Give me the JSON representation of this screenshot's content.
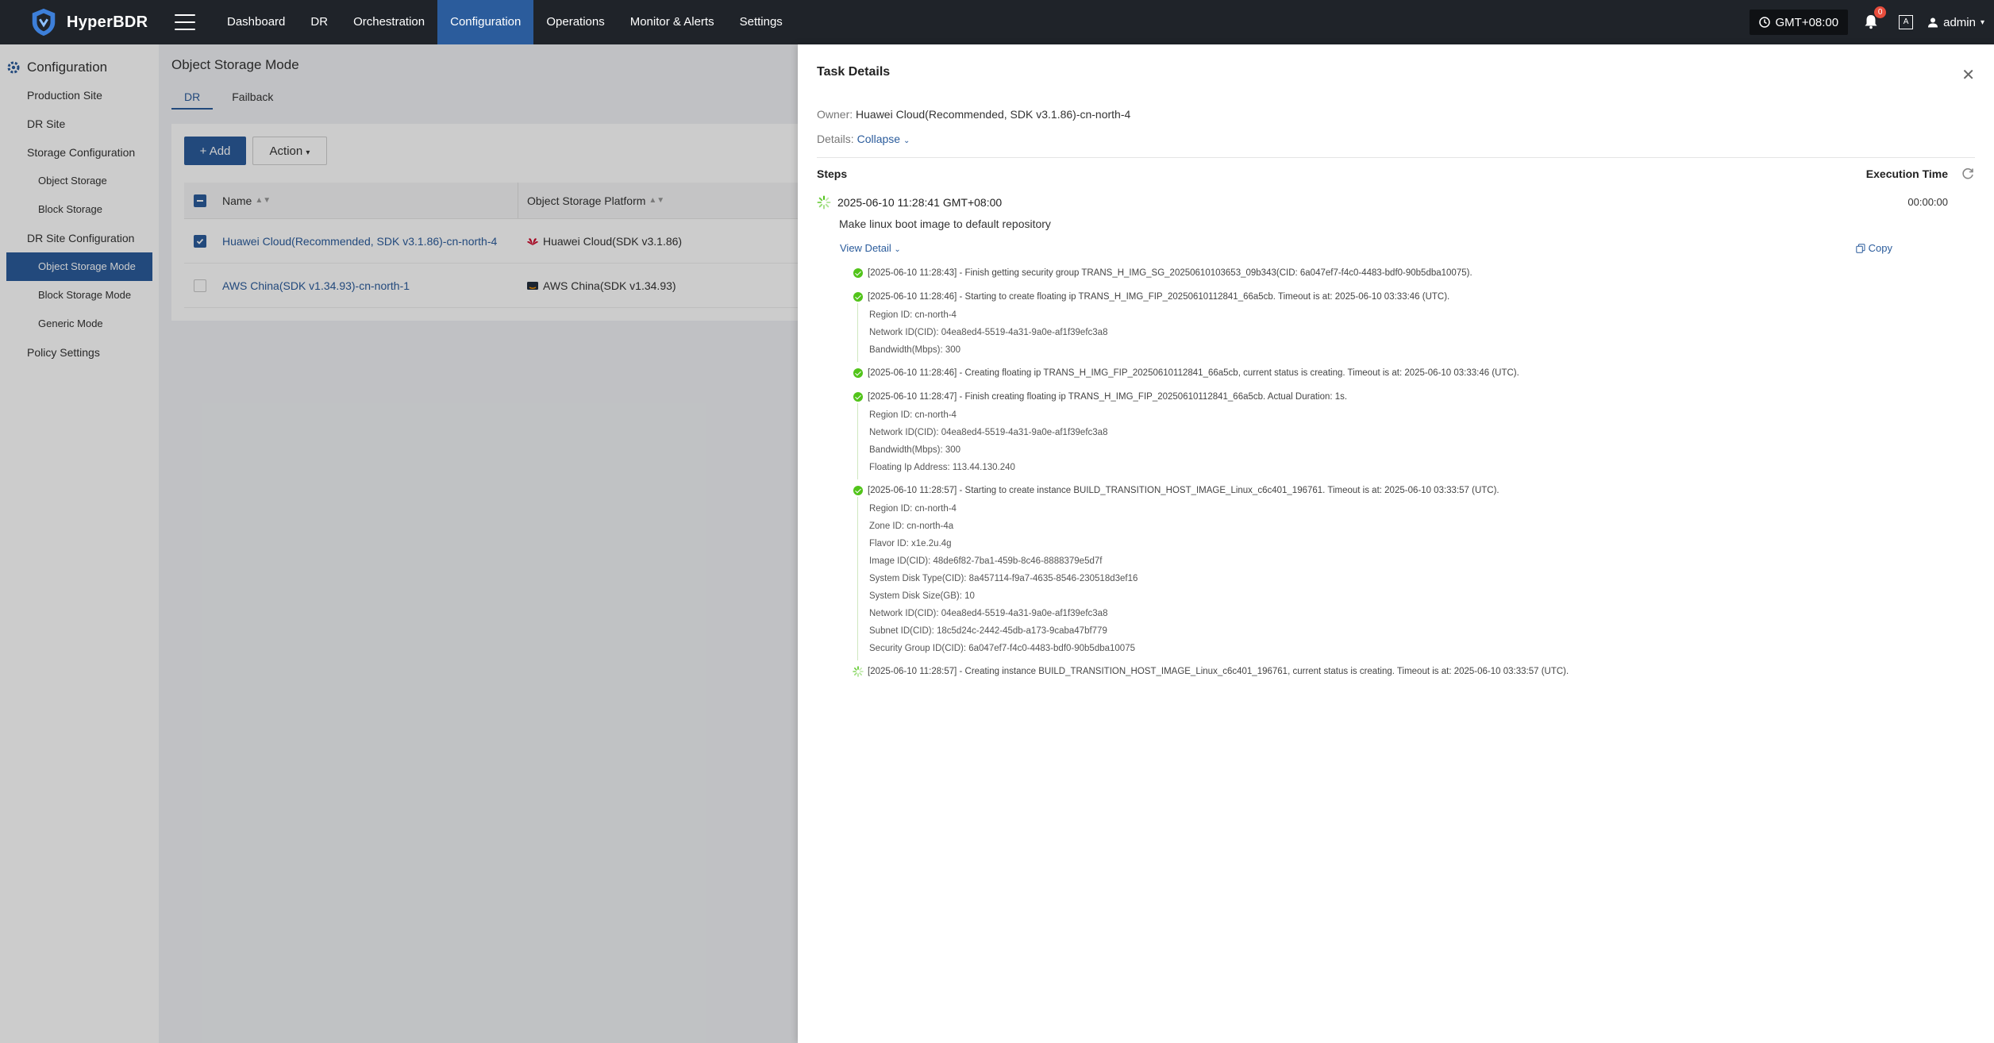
{
  "app": {
    "name": "HyperBDR"
  },
  "nav": [
    "Dashboard",
    "DR",
    "Orchestration",
    "Configuration",
    "Operations",
    "Monitor & Alerts",
    "Settings"
  ],
  "topright": {
    "timezone": "GMT+08:00",
    "notifications": "0",
    "lang_icon": "A",
    "user": "admin"
  },
  "sidebar": {
    "title": "Configuration",
    "items": [
      {
        "label": "Production Site",
        "level": 1
      },
      {
        "label": "DR Site",
        "level": 1
      },
      {
        "label": "Storage Configuration",
        "level": 1
      },
      {
        "label": "Object Storage",
        "level": 2
      },
      {
        "label": "Block Storage",
        "level": 2
      },
      {
        "label": "DR Site Configuration",
        "level": 1
      },
      {
        "label": "Object Storage Mode",
        "level": 2,
        "active": true
      },
      {
        "label": "Block Storage Mode",
        "level": 2
      },
      {
        "label": "Generic Mode",
        "level": 2
      },
      {
        "label": "Policy Settings",
        "level": 1
      }
    ]
  },
  "main": {
    "title": "Object Storage Mode",
    "tabs": [
      "DR",
      "Failback"
    ],
    "add_label": "+ Add",
    "action_label": "Action",
    "columns": [
      "Name",
      "Object Storage Platform"
    ],
    "rows": [
      {
        "name": "Huawei Cloud(Recommended, SDK v3.1.86)-cn-north-4",
        "platform": "Huawei Cloud(SDK v3.1.86)",
        "checked": true
      },
      {
        "name": "AWS China(SDK v1.34.93)-cn-north-1",
        "platform": "AWS China(SDK v1.34.93)",
        "checked": false
      }
    ]
  },
  "drawer": {
    "title": "Task Details",
    "owner_label": "Owner:",
    "owner": "Huawei Cloud(Recommended, SDK v3.1.86)-cn-north-4",
    "details_label": "Details:",
    "collapse": "Collapse",
    "steps_label": "Steps",
    "exec_label": "Execution Time",
    "step_time": "2025-06-10 11:28:41 GMT+08:00",
    "step_duration": "00:00:00",
    "step_desc": "Make linux boot image to default repository",
    "view_detail": "View Detail",
    "copy": "Copy",
    "logs": [
      {
        "status": "done",
        "main": "[2025-06-10 11:28:43] - Finish getting security group TRANS_H_IMG_SG_20250610103653_09b343(CID: 6a047ef7-f4c0-4483-bdf0-90b5dba10075).",
        "subs": []
      },
      {
        "status": "done",
        "main": "[2025-06-10 11:28:46] - Starting to create floating ip TRANS_H_IMG_FIP_20250610112841_66a5cb. Timeout is at: 2025-06-10 03:33:46 (UTC).",
        "subs": [
          "Region ID: cn-north-4",
          "Network ID(CID): 04ea8ed4-5519-4a31-9a0e-af1f39efc3a8",
          "Bandwidth(Mbps): 300"
        ]
      },
      {
        "status": "done",
        "main": "[2025-06-10 11:28:46] - Creating floating ip TRANS_H_IMG_FIP_20250610112841_66a5cb, current status is creating. Timeout is at: 2025-06-10 03:33:46 (UTC).",
        "subs": []
      },
      {
        "status": "done",
        "main": "[2025-06-10 11:28:47] - Finish creating floating ip TRANS_H_IMG_FIP_20250610112841_66a5cb. Actual Duration: 1s.",
        "subs": [
          "Region ID: cn-north-4",
          "Network ID(CID): 04ea8ed4-5519-4a31-9a0e-af1f39efc3a8",
          "Bandwidth(Mbps): 300",
          "Floating Ip Address: 113.44.130.240"
        ]
      },
      {
        "status": "done",
        "main": "[2025-06-10 11:28:57] - Starting to create instance BUILD_TRANSITION_HOST_IMAGE_Linux_c6c401_196761. Timeout is at: 2025-06-10 03:33:57 (UTC).",
        "subs": [
          "Region ID: cn-north-4",
          "Zone ID: cn-north-4a",
          "Flavor ID: x1e.2u.4g",
          "Image ID(CID): 48de6f82-7ba1-459b-8c46-8888379e5d7f",
          "System Disk Type(CID): 8a457114-f9a7-4635-8546-230518d3ef16",
          "System Disk Size(GB): 10",
          "Network ID(CID): 04ea8ed4-5519-4a31-9a0e-af1f39efc3a8",
          "Subnet ID(CID): 18c5d24c-2442-45db-a173-9caba47bf779",
          "Security Group ID(CID): 6a047ef7-f4c0-4483-bdf0-90b5dba10075"
        ]
      },
      {
        "status": "running",
        "main": "[2025-06-10 11:28:57] - Creating instance BUILD_TRANSITION_HOST_IMAGE_Linux_c6c401_196761, current status is creating. Timeout is at: 2025-06-10 03:33:57 (UTC).",
        "subs": []
      }
    ]
  },
  "colors": {
    "topbar": "#1f2329",
    "accent": "#2b5c9c",
    "success": "#52c41a"
  }
}
